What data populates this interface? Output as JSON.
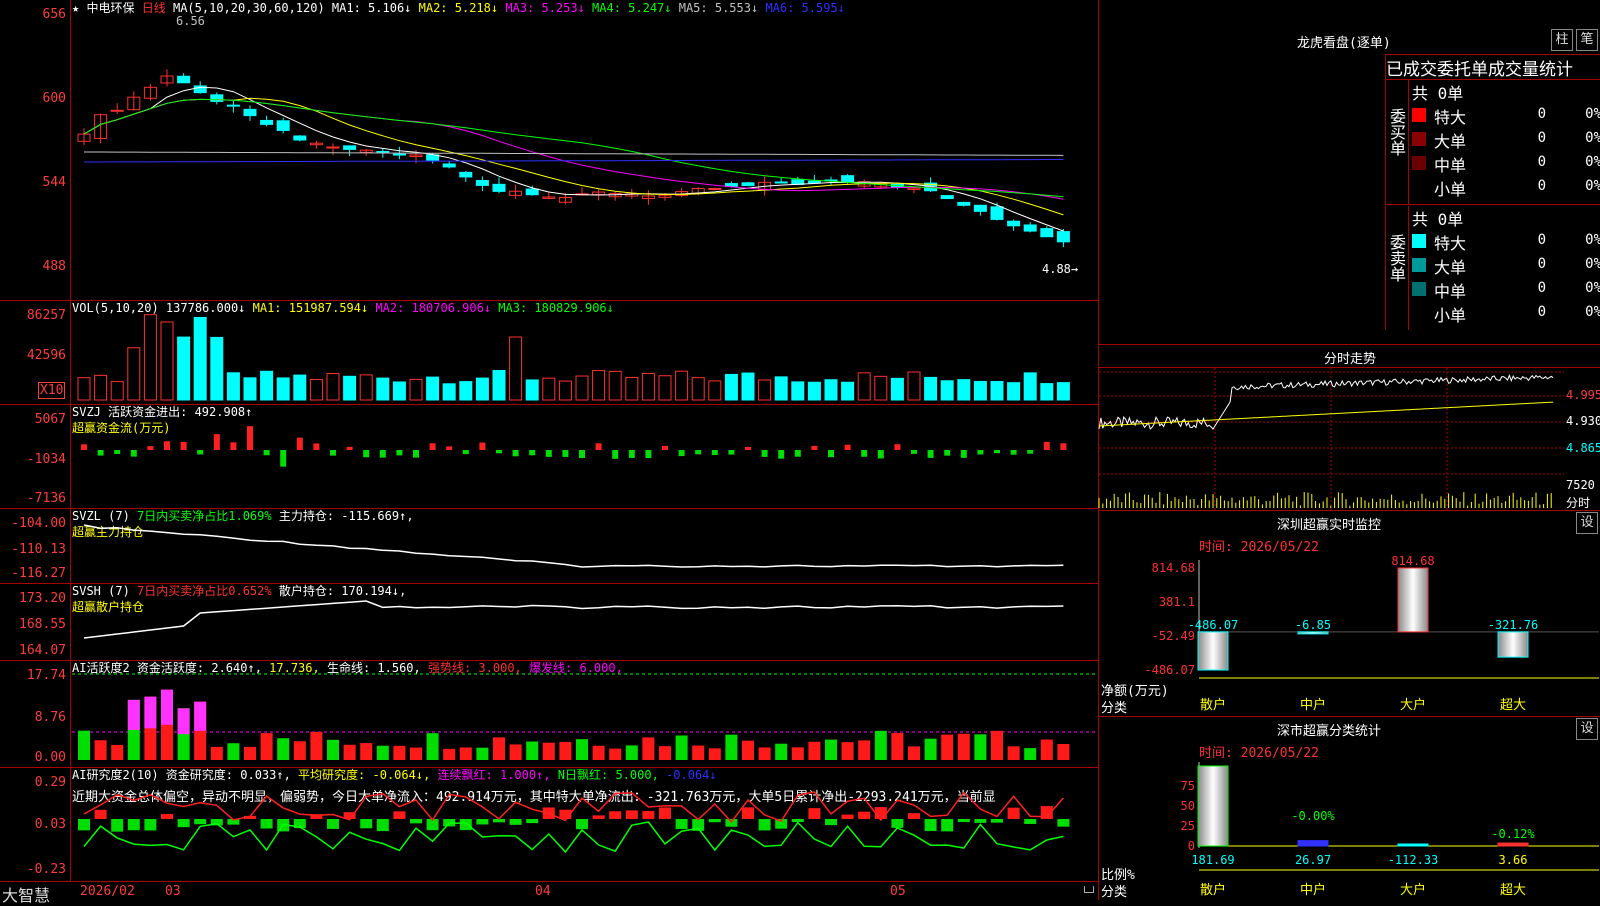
{
  "header": {
    "star": "★",
    "stock_name": "中电环保",
    "period": "日线",
    "ma_label": "MA(5,10,20,30,60,120)",
    "ma_items": [
      {
        "text": "MA1: 5.106↓",
        "color": "#ffffff"
      },
      {
        "text": "MA2: 5.218↓",
        "color": "#ffff00"
      },
      {
        "text": "MA3: 5.253↓",
        "color": "#ff00ff"
      },
      {
        "text": "MA4: 5.247↓",
        "color": "#00ff00"
      },
      {
        "text": "MA5: 5.553↓",
        "color": "#c0c0c0"
      },
      {
        "text": "MA6: 5.595↓",
        "color": "#3030ff"
      }
    ]
  },
  "price_pane": {
    "y_labels": [
      "656",
      "600",
      "544",
      "488"
    ],
    "high_mark": "6.56",
    "low_mark": "4.88→"
  },
  "vol_pane": {
    "y_labels": [
      "86257",
      "42596"
    ],
    "unit": "X10",
    "legend": [
      {
        "text": "VOL(5,10,20)  137786.000↓",
        "color": "#ffffff"
      },
      {
        "text": "MA1: 151987.594↓",
        "color": "#ffff00"
      },
      {
        "text": "MA2: 180706.906↓",
        "color": "#ff00ff"
      },
      {
        "text": "MA3: 180829.906↓",
        "color": "#00ff00"
      }
    ]
  },
  "svzj_pane": {
    "y_labels": [
      "5067",
      "-1034",
      "-7136"
    ],
    "line1": "SVZJ  活跃资金进出: 492.908↑",
    "line2": "超赢资金流(万元)"
  },
  "svzl_pane": {
    "y_labels": [
      "-104.00",
      "-110.13",
      "-116.27"
    ],
    "line1_a": "SVZL (7)",
    "line1_b": "7日内买卖净占比1.069%",
    "line1_c": "主力持仓: -115.669↑,",
    "line2": "超赢主力持仓"
  },
  "svsh_pane": {
    "y_labels": [
      "173.20",
      "168.55",
      "164.07"
    ],
    "line1_a": "SVSH (7)",
    "line1_b": "7日内买卖净占比0.652%",
    "line1_c": "散户持仓: 170.194↓,",
    "line2": "超赢散户持仓"
  },
  "ai_active_pane": {
    "y_labels": [
      "17.74",
      "8.76",
      "0.00"
    ],
    "legend": [
      {
        "text": "AI活跃度2  资金活跃度: 2.640↑,",
        "color": "#ffffff"
      },
      {
        "text": "17.736,",
        "color": "#ffff00"
      },
      {
        "text": "生命线: 1.560,",
        "color": "#ffffff"
      },
      {
        "text": "强势线: 3.000,",
        "color": "#ff3030"
      },
      {
        "text": "爆发线: 6.000,",
        "color": "#ff00ff"
      }
    ]
  },
  "ai_research_pane": {
    "y_labels": [
      "0.29",
      "0.03",
      "-0.23"
    ],
    "legend": [
      {
        "text": "AI研究度2(10)  资金研究度: 0.033↑,",
        "color": "#ffffff"
      },
      {
        "text": "平均研究度: -0.064↓,",
        "color": "#ffff00"
      },
      {
        "text": "连续飘红: 1.000↑,",
        "color": "#ff00ff"
      },
      {
        "text": "N日飘红: 5.000,",
        "color": "#00ff00"
      },
      {
        "text": "-0.064↓",
        "color": "#3030ff"
      }
    ],
    "comment": "近期大资金总体偏空，异动不明显，偏弱势，今日大单净流入：492.914万元，其中特大单净流出：-321.763万元，大单5日累计净出-2293.241万元，当前显"
  },
  "date_axis": {
    "brand": "大智慧",
    "labels": [
      {
        "text": "2026/02"
      },
      {
        "text": "03"
      },
      {
        "text": "04"
      },
      {
        "text": "05"
      }
    ]
  },
  "order_panel": {
    "title": "龙虎看盘(逐单)",
    "btn_bar": "柱",
    "btn_pen": "笔",
    "header": "已成交委托单成交量统计",
    "buy_label": "委买单",
    "sell_label": "委卖单",
    "buy_total": "共 0单",
    "sell_total": "共 0单",
    "buy_rows": [
      {
        "label": "特大",
        "qty": "0",
        "pct": "0%",
        "color": "#ff0000"
      },
      {
        "label": "大单",
        "qty": "0",
        "pct": "0%",
        "color": "#8b0000"
      },
      {
        "label": "中单",
        "qty": "0",
        "pct": "0%",
        "color": "#6b0000"
      },
      {
        "label": "小单",
        "qty": "0",
        "pct": "0%",
        "color": ""
      }
    ],
    "sell_rows": [
      {
        "label": "特大",
        "qty": "0",
        "pct": "0%",
        "color": "#00ffff"
      },
      {
        "label": "大单",
        "qty": "0",
        "pct": "0%",
        "color": "#009a9a"
      },
      {
        "label": "中单",
        "qty": "0",
        "pct": "0%",
        "color": "#007070"
      },
      {
        "label": "小单",
        "qty": "0",
        "pct": "0%",
        "color": ""
      }
    ]
  },
  "intraday_panel": {
    "title": "分时走势",
    "y_labels": [
      "4.995",
      "4.930",
      "4.865"
    ],
    "vol_label": "7520",
    "vol_unit": "分时"
  },
  "sz_monitor": {
    "title": "深圳超赢实时监控",
    "btn": "设",
    "time_label": "时间: 2026/05/22",
    "y_labels": [
      "814.68",
      "381.1",
      "-52.49",
      "-486.07"
    ],
    "value_labels": [
      "-486.07",
      "-6.85",
      "814.68",
      "-321.76"
    ],
    "axis_title_1": "净额(万元)",
    "axis_title_2": "分类",
    "categories": [
      "散户",
      "中户",
      "大户",
      "超大"
    ],
    "chart_data": {
      "type": "bar",
      "categories": [
        "散户",
        "中户",
        "大户",
        "超大"
      ],
      "values": [
        -486.07,
        -6.85,
        814.68,
        -321.76
      ],
      "ylim": [
        -486.07,
        814.68
      ]
    }
  },
  "sz_class": {
    "title": "深市超赢分类统计",
    "btn": "设",
    "time_label": "时间: 2026/05/22",
    "y_labels": [
      "75",
      "50",
      "25",
      "0"
    ],
    "pct_labels": [
      "-0.00%",
      "-0.12%"
    ],
    "bottom_values": [
      "181.69",
      "26.97",
      "-112.33",
      "3.66"
    ],
    "axis_title_1": "比例%",
    "axis_title_2": "分类",
    "categories": [
      "散户",
      "中户",
      "大户",
      "超大"
    ],
    "chart_data": {
      "type": "bar",
      "categories": [
        "散户",
        "中户",
        "大户",
        "超大"
      ],
      "values": [
        100,
        26.97,
        0,
        3.66
      ],
      "ylim": [
        0,
        100
      ]
    }
  }
}
